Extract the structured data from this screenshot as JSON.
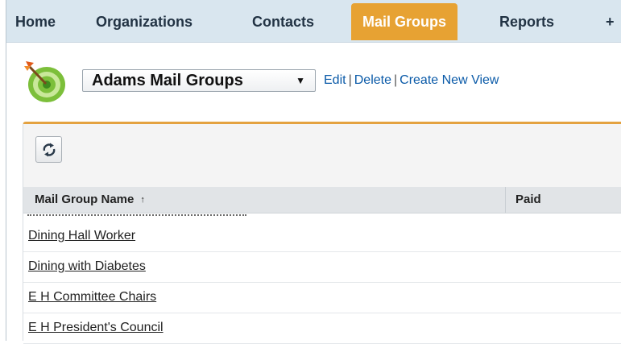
{
  "tabs": [
    {
      "label": "Home",
      "active": false
    },
    {
      "label": "Organizations",
      "active": false
    },
    {
      "label": "Contacts",
      "active": false
    },
    {
      "label": "Mail Groups",
      "active": true
    },
    {
      "label": "Reports",
      "active": false
    },
    {
      "label": "+",
      "active": false
    }
  ],
  "view": {
    "selected": "Adams Mail Groups",
    "caret": "▼",
    "links": {
      "edit": "Edit",
      "delete": "Delete",
      "create": "Create New View",
      "separator": "|"
    }
  },
  "list": {
    "columns": {
      "name": "Mail Group Name",
      "sort_indicator": "↑",
      "paid": "Paid"
    },
    "rows": [
      {
        "name": "Dining Hall Worker"
      },
      {
        "name": "Dining with Diabetes"
      },
      {
        "name": "E H Committee Chairs"
      },
      {
        "name": "E H President's Council"
      }
    ]
  },
  "colors": {
    "active_tab": "#e7a233",
    "tab_bar": "#d9e6ef",
    "link": "#0a5aa8",
    "panel_accent": "#e4a240"
  },
  "icons": {
    "view_icon": "target-icon",
    "refresh": "refresh-icon"
  }
}
